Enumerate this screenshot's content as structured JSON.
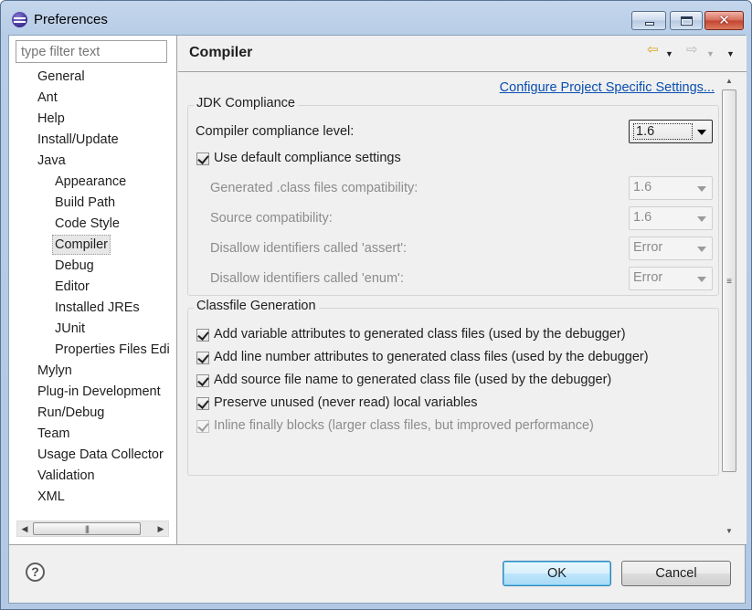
{
  "window": {
    "title": "Preferences"
  },
  "filter": {
    "placeholder": "type filter text"
  },
  "tree": [
    {
      "label": "General",
      "level": 0
    },
    {
      "label": "Ant",
      "level": 0
    },
    {
      "label": "Help",
      "level": 0
    },
    {
      "label": "Install/Update",
      "level": 0
    },
    {
      "label": "Java",
      "level": 0
    },
    {
      "label": "Appearance",
      "level": 1
    },
    {
      "label": "Build Path",
      "level": 1
    },
    {
      "label": "Code Style",
      "level": 1
    },
    {
      "label": "Compiler",
      "level": 1,
      "selected": true
    },
    {
      "label": "Debug",
      "level": 1
    },
    {
      "label": "Editor",
      "level": 1
    },
    {
      "label": "Installed JREs",
      "level": 1
    },
    {
      "label": "JUnit",
      "level": 1
    },
    {
      "label": "Properties Files Edi",
      "level": 1
    },
    {
      "label": "Mylyn",
      "level": 0
    },
    {
      "label": "Plug-in Development",
      "level": 0
    },
    {
      "label": "Run/Debug",
      "level": 0
    },
    {
      "label": "Team",
      "level": 0
    },
    {
      "label": "Usage Data Collector",
      "level": 0
    },
    {
      "label": "Validation",
      "level": 0
    },
    {
      "label": "XML",
      "level": 0
    }
  ],
  "page": {
    "title": "Compiler",
    "configure_link": "Configure Project Specific Settings...",
    "jdk": {
      "title": "JDK Compliance",
      "compliance_label": "Compiler compliance level:",
      "compliance_value": "1.6",
      "use_default_label": "Use default compliance settings",
      "use_default_checked": true,
      "class_compat_label": "Generated .class files compatibility:",
      "class_compat_value": "1.6",
      "source_compat_label": "Source compatibility:",
      "source_compat_value": "1.6",
      "assert_label": "Disallow identifiers called 'assert':",
      "assert_value": "Error",
      "enum_label": "Disallow identifiers called 'enum':",
      "enum_value": "Error"
    },
    "classfile": {
      "title": "Classfile Generation",
      "options": [
        {
          "label": "Add variable attributes to generated class files (used by the debugger)",
          "checked": true,
          "enabled": true
        },
        {
          "label": "Add line number attributes to generated class files (used by the debugger)",
          "checked": true,
          "enabled": true
        },
        {
          "label": "Add source file name to generated class file (used by the debugger)",
          "checked": true,
          "enabled": true
        },
        {
          "label": "Preserve unused (never read) local variables",
          "checked": true,
          "enabled": true
        },
        {
          "label": "Inline finally blocks (larger class files, but improved performance)",
          "checked": true,
          "enabled": false
        }
      ]
    }
  },
  "buttons": {
    "ok": "OK",
    "cancel": "Cancel",
    "help": "?"
  },
  "icons": {
    "app": "eclipse-icon",
    "back": "back-arrow-icon",
    "forward": "forward-arrow-icon",
    "menu": "view-menu-icon"
  }
}
